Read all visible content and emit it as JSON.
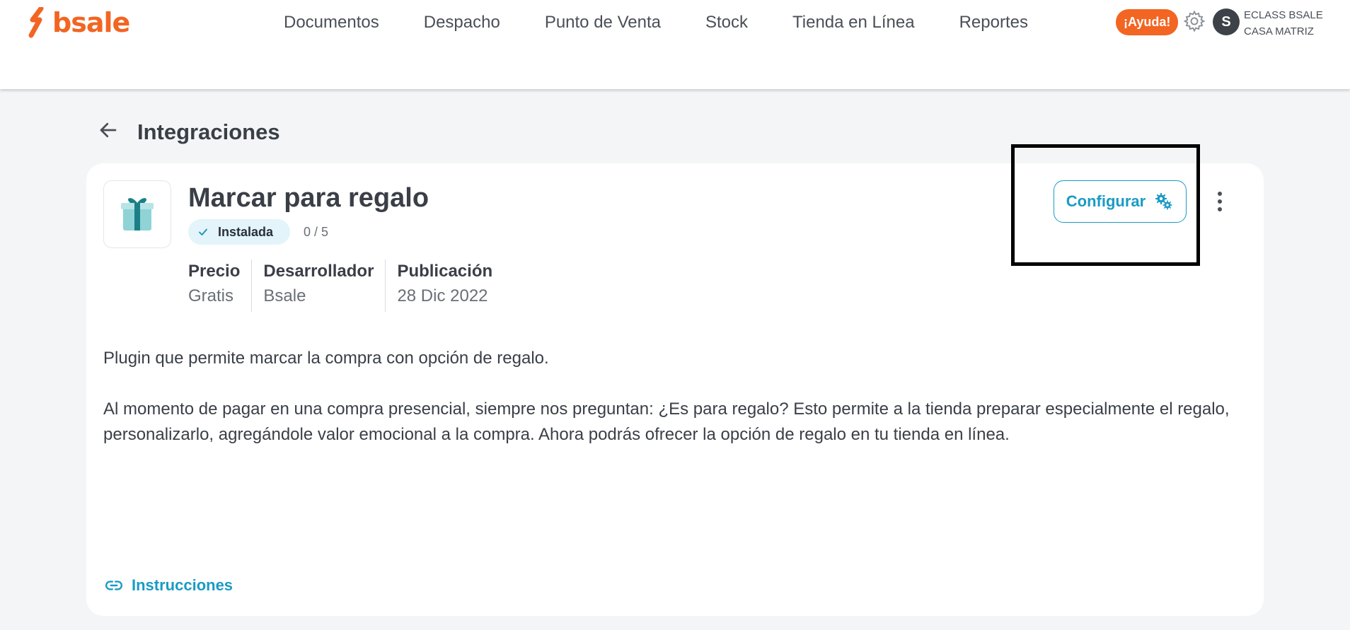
{
  "colors": {
    "brand_orange": "#f26522",
    "accent_blue": "#1a9bc4",
    "installed_bg": "#e3f4fa",
    "installed_check": "#1a8fb5",
    "gift_light": "#8fd3d6",
    "gift_dark": "#1b7f87"
  },
  "header": {
    "logo_text": "bsale",
    "nav": [
      "Documentos",
      "Despacho",
      "Punto de Venta",
      "Stock",
      "Tienda en Línea",
      "Reportes"
    ],
    "help_label": "¡Ayuda!",
    "settings_icon": "gear-icon",
    "avatar_initial": "S",
    "account_name": "ECLASS BSALE",
    "account_branch": "CASA MATRIZ"
  },
  "page": {
    "back_icon": "arrow-left-icon",
    "title": "Integraciones"
  },
  "app": {
    "icon": "gift-icon",
    "name": "Marcar para regalo",
    "status": "Instalada",
    "rating": "0 / 5",
    "meta": [
      {
        "label": "Precio",
        "value": "Gratis"
      },
      {
        "label": "Desarrollador",
        "value": "Bsale"
      },
      {
        "label": "Publicación",
        "value": "28 Dic 2022"
      }
    ],
    "description": [
      "Plugin que permite marcar la compra con opción de regalo.",
      "Al momento de pagar en una compra presencial, siempre nos preguntan: ¿Es para regalo? Esto permite a la tienda preparar especialmente el regalo, personalizarlo, agregándole valor emocional a la compra. Ahora podrás ofrecer la opción de regalo en tu tienda en línea."
    ],
    "configure_label": "Configurar",
    "configure_icon": "gears-icon",
    "more_icon": "kebab-menu-icon",
    "instructions_label": "Instrucciones",
    "instructions_icon": "link-icon"
  }
}
